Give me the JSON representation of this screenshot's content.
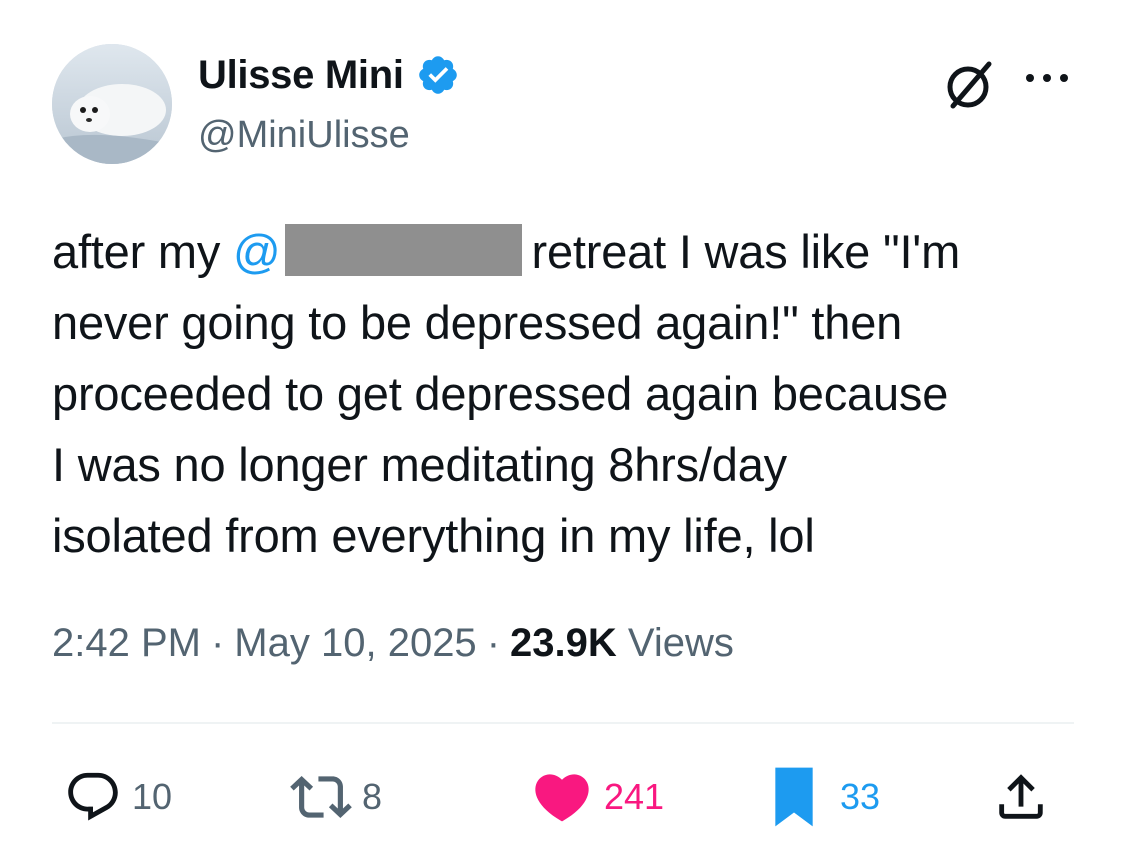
{
  "author": {
    "display_name": "Ulisse Mini",
    "handle": "@MiniUlisse",
    "verified": true,
    "avatar_icon": "seal-pup-avatar"
  },
  "header_icons": {
    "grok": "grok-icon",
    "more": "more-options-icon"
  },
  "tweet": {
    "lines": [
      {
        "before": "after my ",
        "mention": "@",
        "after": "retreat I was like \"I'm"
      },
      {
        "text": "never going to be depressed again!\" then"
      },
      {
        "text": "proceeded to get depressed again because"
      },
      {
        "text": "I was no longer meditating 8hrs/day"
      },
      {
        "text": "isolated from everything in my life, lol"
      }
    ]
  },
  "meta": {
    "time": "2:42 PM",
    "separator": "·",
    "date": "May 10, 2025",
    "views_count": "23.9K",
    "views_label": "Views"
  },
  "actions": {
    "reply": {
      "icon": "reply-icon",
      "count": "10"
    },
    "retweet": {
      "icon": "retweet-icon",
      "count": "8"
    },
    "like": {
      "icon": "heart-icon",
      "count": "241"
    },
    "bookmark": {
      "icon": "bookmark-icon",
      "count": "33"
    },
    "share": {
      "icon": "share-icon"
    }
  },
  "colors": {
    "accent_blue": "#1d9bf0",
    "like_pink": "#f91880",
    "text_primary": "#0f1419",
    "text_secondary": "#536471",
    "divider": "#eff3f4",
    "redaction": "#8f8f8f"
  }
}
